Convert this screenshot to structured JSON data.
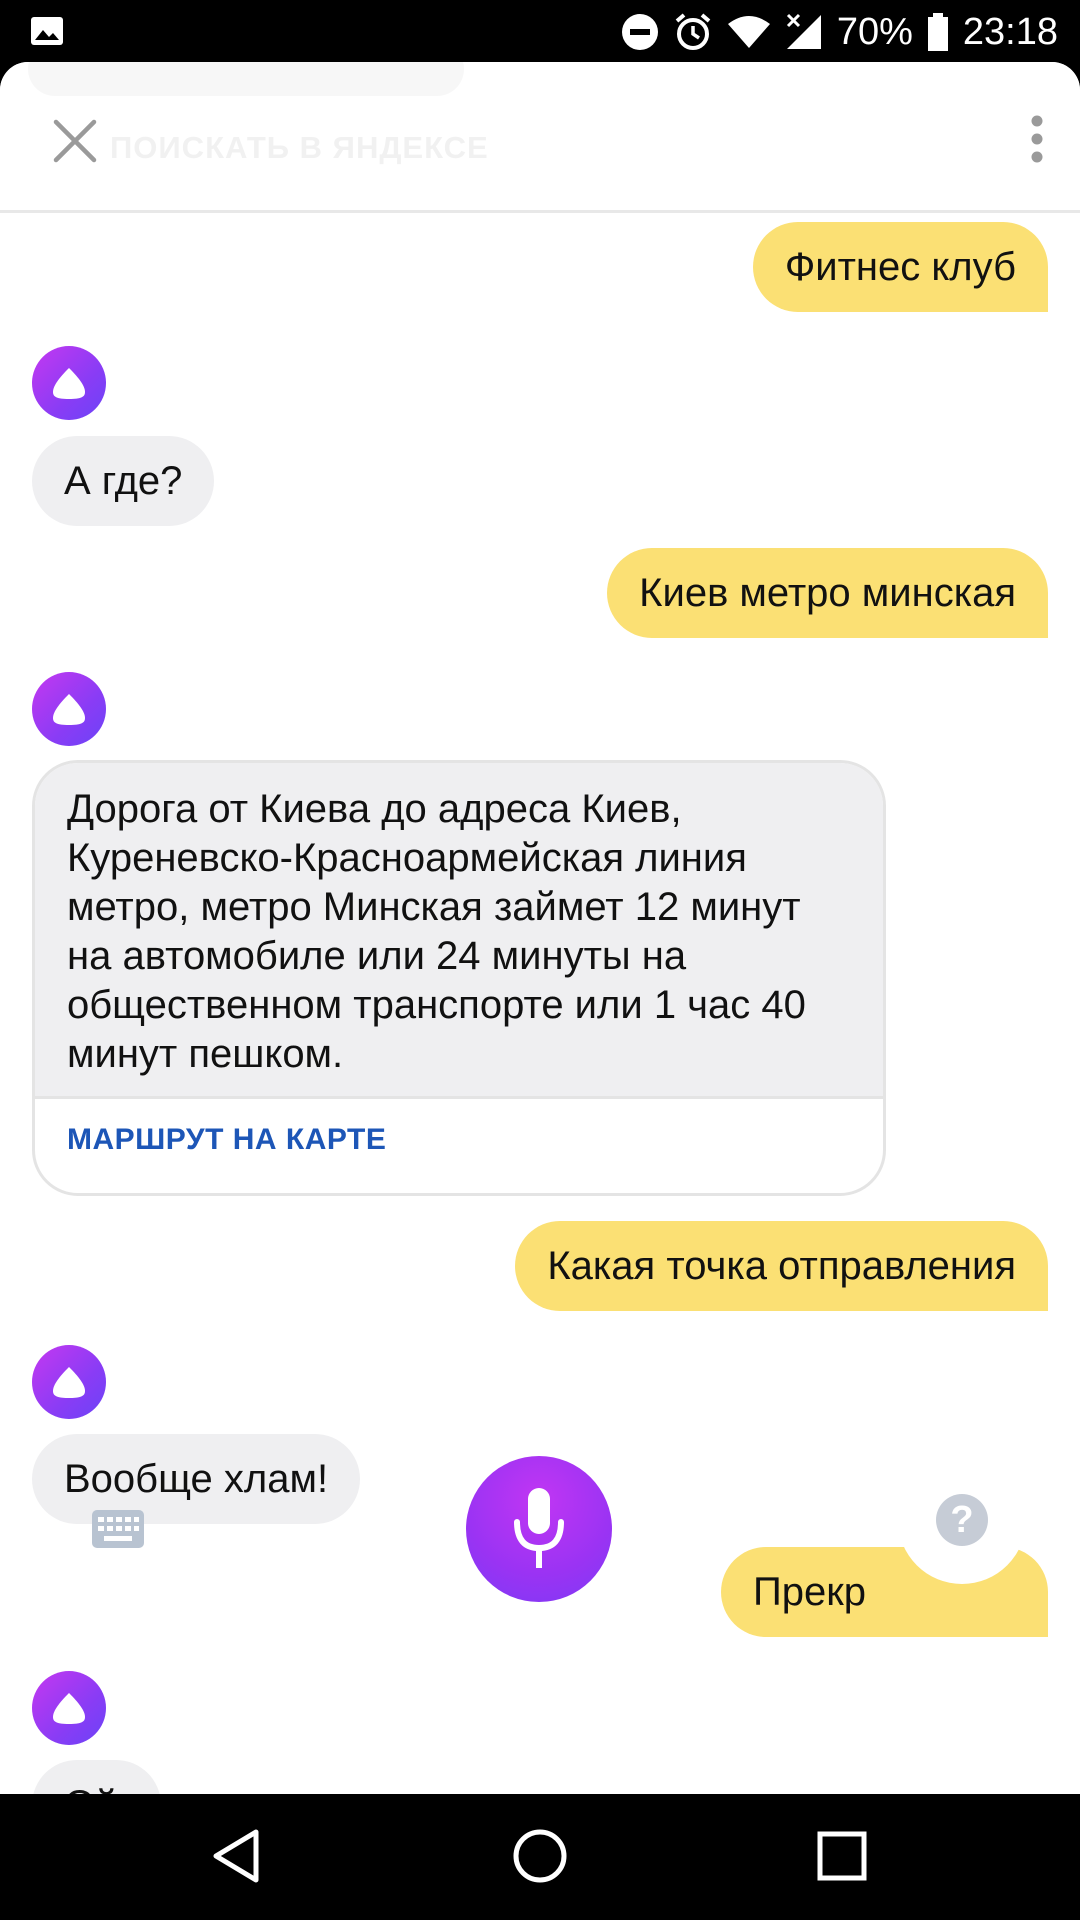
{
  "status_bar": {
    "battery": "70%",
    "time": "23:18",
    "icons": [
      "image-icon",
      "do-not-disturb-icon",
      "alarm-icon",
      "wifi-icon",
      "signal-icon",
      "battery-icon"
    ]
  },
  "header": {
    "ghost_text": "ПОИСКАТЬ В ЯНДЕКСЕ",
    "icons": [
      "close-icon",
      "more-vert-icon"
    ]
  },
  "messages": [
    {
      "from": "user",
      "text": "Фитнес клуб"
    },
    {
      "from": "alice",
      "text": "А где?"
    },
    {
      "from": "user",
      "text": "Киев метро минская"
    },
    {
      "from": "alice",
      "card": {
        "lines": [
          "Дорога от Киева до адреса Киев,",
          "Куреневско-Красноармейская линия",
          "метро, метро Минская займет 12 минут",
          "на автомобиле или 24 минуты на",
          "общественном транспорте или 1 час 40",
          "минут пешком."
        ],
        "link": "МАРШРУТ НА КАРТЕ"
      }
    },
    {
      "from": "user",
      "text": "Какая точка отправления"
    },
    {
      "from": "alice",
      "text": "Вообще хлам!"
    },
    {
      "from": "user",
      "text": "Прекр"
    },
    {
      "from": "alice",
      "text": "Ой, "
    }
  ],
  "controls": {
    "help_label": "?",
    "icons": [
      "keyboard-icon",
      "microphone-icon",
      "help-icon"
    ]
  },
  "nav_bar": {
    "icons": [
      "back-icon",
      "home-icon",
      "recents-icon"
    ]
  },
  "colors": {
    "user_bubble": "#fbe074",
    "alice_bubble": "#efeff1",
    "accent_purple": "#8a3cf5",
    "link_blue": "#1d56b7"
  }
}
